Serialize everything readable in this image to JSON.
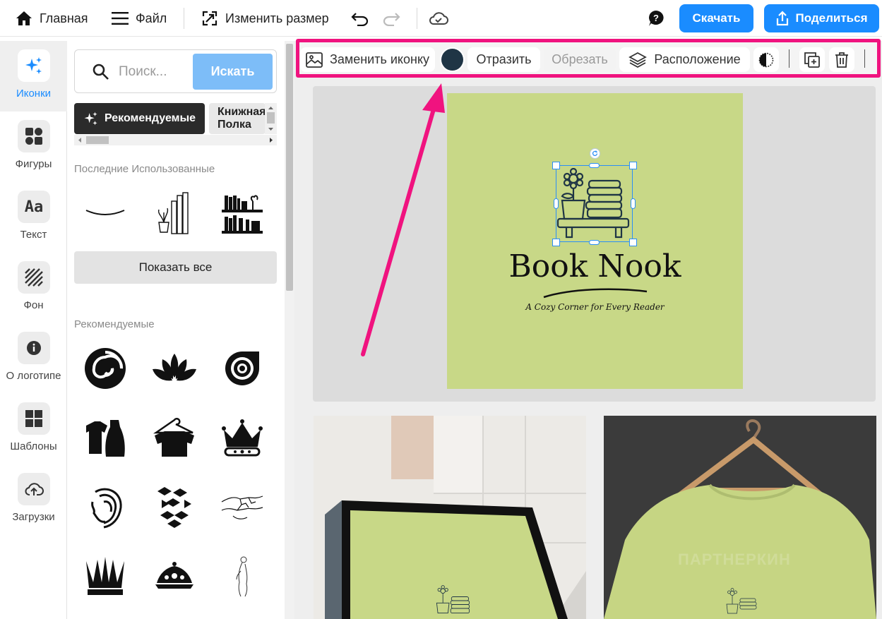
{
  "topbar": {
    "home_label": "Главная",
    "file_label": "Файл",
    "resize_label": "Изменить размер",
    "download_label": "Скачать",
    "share_label": "Поделиться"
  },
  "rail": {
    "items": [
      {
        "label": "Иконки",
        "icon": "sparkles-icon",
        "active": true
      },
      {
        "label": "Фигуры",
        "icon": "shapes-icon"
      },
      {
        "label": "Текст",
        "icon": "text-icon"
      },
      {
        "label": "Фон",
        "icon": "background-icon"
      },
      {
        "label": "О логотипе",
        "icon": "info-icon"
      },
      {
        "label": "Шаблоны",
        "icon": "templates-icon"
      },
      {
        "label": "Загрузки",
        "icon": "upload-icon"
      }
    ]
  },
  "panel": {
    "search_placeholder": "Поиск...",
    "search_button": "Искать",
    "chip_recommended": "Рекомендуемые",
    "chip_bookshelf": "Книжная Полка",
    "recent_title": "Последние Использованные",
    "show_all": "Показать все",
    "recommended_title": "Рекомендуемые"
  },
  "toolbar": {
    "replace_icon": "Заменить иконку",
    "color": "#1f3545",
    "flip": "Отразить",
    "crop": "Обрезать",
    "arrange": "Расположение"
  },
  "logo": {
    "title": "Book Nook",
    "subtitle": "A Cozy Corner for Every Reader",
    "background": "#c8d887"
  },
  "watermark": "ПАРТНЕРКИН",
  "colors": {
    "accent": "#1a8cff",
    "highlight": "#f0137f"
  }
}
